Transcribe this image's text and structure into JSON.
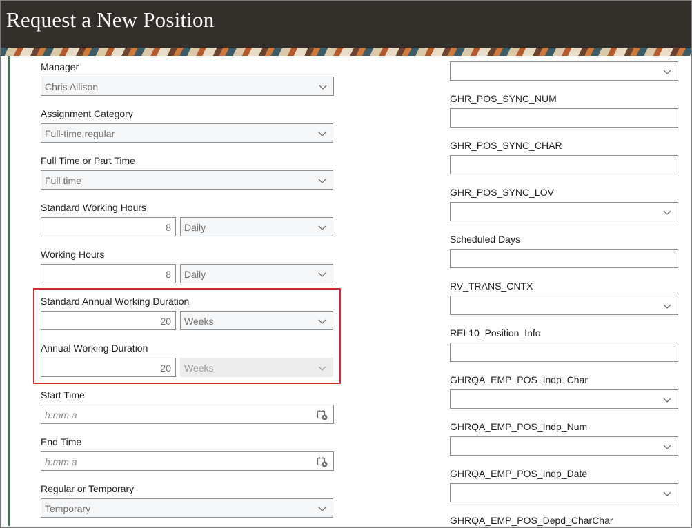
{
  "header": {
    "title": "Request a New Position"
  },
  "left": {
    "manager": {
      "label": "Manager",
      "value": "Chris Allison"
    },
    "assignment_category": {
      "label": "Assignment Category",
      "value": "Full-time regular"
    },
    "full_or_part": {
      "label": "Full Time or Part Time",
      "value": "Full time"
    },
    "std_working_hours": {
      "label": "Standard Working Hours",
      "value": "8",
      "frequency": "Daily"
    },
    "working_hours": {
      "label": "Working Hours",
      "value": "8",
      "frequency": "Daily"
    },
    "std_annual_duration": {
      "label": "Standard Annual Working Duration",
      "value": "20",
      "unit": "Weeks"
    },
    "annual_duration": {
      "label": "Annual Working Duration",
      "value": "20",
      "unit": "Weeks"
    },
    "start_time": {
      "label": "Start Time",
      "placeholder": "h:mm a"
    },
    "end_time": {
      "label": "End Time",
      "placeholder": "h:mm a"
    },
    "regular_or_temp": {
      "label": "Regular or Temporary",
      "value": "Temporary"
    }
  },
  "right": {
    "fields": [
      {
        "label": "GHR_POS_SYNC_NUM"
      },
      {
        "label": "GHR_POS_SYNC_CHAR"
      },
      {
        "label": "GHR_POS_SYNC_LOV"
      },
      {
        "label": "Scheduled Days"
      },
      {
        "label": "RV_TRANS_CNTX"
      },
      {
        "label": "REL10_Position_Info"
      },
      {
        "label": "GHRQA_EMP_POS_Indp_Char"
      },
      {
        "label": "GHRQA_EMP_POS_Indp_Num"
      },
      {
        "label": "GHRQA_EMP_POS_Indp_Date"
      },
      {
        "label": "GHRQA_EMP_POS_Depd_CharChar"
      }
    ]
  },
  "colors": {
    "header_bg": "#322f2b",
    "highlight_border": "#d22b2b",
    "accent_rule": "#2e7d4f"
  }
}
